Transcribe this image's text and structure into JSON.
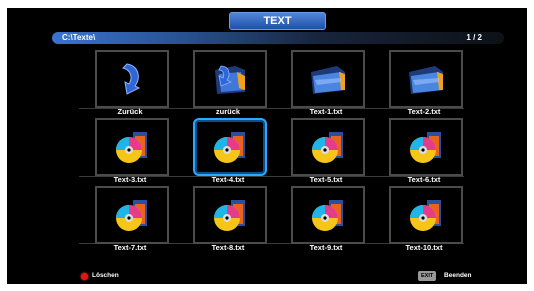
{
  "header": {
    "title": "TEXT"
  },
  "path_bar": {
    "path": "C:\\Texte\\",
    "page": "1 / 2"
  },
  "grid": {
    "items": [
      {
        "label": "Zurück",
        "icon": "back-arrow-icon"
      },
      {
        "label": "zurück",
        "icon": "back-folder-icon"
      },
      {
        "label": "Text-1.txt",
        "icon": "folder-icon"
      },
      {
        "label": "Text-2.txt",
        "icon": "folder-icon"
      },
      {
        "label": "Text-3.txt",
        "icon": "media-disc-icon"
      },
      {
        "label": "Text-4.txt",
        "icon": "media-disc-icon"
      },
      {
        "label": "Text-5.txt",
        "icon": "media-disc-icon"
      },
      {
        "label": "Text-6.txt",
        "icon": "media-disc-icon"
      },
      {
        "label": "Text-7.txt",
        "icon": "media-disc-icon"
      },
      {
        "label": "Text-8.txt",
        "icon": "media-disc-icon"
      },
      {
        "label": "Text-9.txt",
        "icon": "media-disc-icon"
      },
      {
        "label": "Text-10.txt",
        "icon": "media-disc-icon"
      }
    ]
  },
  "footer": {
    "delete_label": "Löschen",
    "delete_key_color": "#e11111",
    "exit_key": "EXIT",
    "exit_label": "Beenden"
  },
  "colors": {
    "accent": "#2f6fd0",
    "selection": "#2aa9ff"
  }
}
